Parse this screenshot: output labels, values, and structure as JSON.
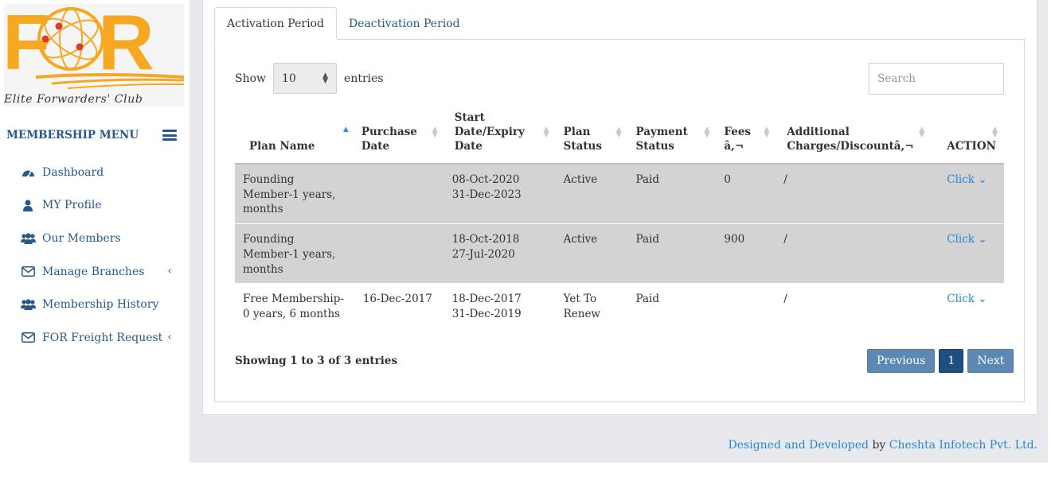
{
  "logo": {
    "tagline": "Elite Forwarders' Club",
    "brand_color": "#f7a823",
    "letters": "FOR"
  },
  "sidebar": {
    "title": "MEMBERSHIP MENU",
    "items": [
      {
        "label": "Dashboard",
        "icon": "dashboard-icon"
      },
      {
        "label": "MY Profile",
        "icon": "user-icon"
      },
      {
        "label": "Our Members",
        "icon": "users-icon"
      },
      {
        "label": "Manage Branches",
        "icon": "envelope-icon",
        "has_submenu": true
      },
      {
        "label": "Membership History",
        "icon": "users-icon"
      },
      {
        "label": "FOR Freight Request",
        "icon": "envelope-icon",
        "has_submenu": true
      }
    ]
  },
  "tabs": [
    {
      "label": "Activation Period",
      "active": true
    },
    {
      "label": "Deactivation Period",
      "active": false
    }
  ],
  "table_controls": {
    "show_label": "Show",
    "entries_value": "10",
    "entries_label": "entries",
    "search_placeholder": "Search"
  },
  "table": {
    "columns": [
      "Plan Name",
      "Purchase Date",
      "Start Date/Expiry Date",
      "Plan Status",
      "Payment Status",
      "Fees â,¬",
      "Additional Charges/Discountâ,¬",
      "ACTION"
    ],
    "sorted_column": "Plan Name",
    "rows": [
      {
        "plan_name": "Founding Member-1 years, months",
        "purchase_date": "",
        "start_date": "08-Oct-2020",
        "expiry_date": "31-Dec-2023",
        "plan_status": "Active",
        "payment_status": "Paid",
        "fees": "0",
        "additional": "/",
        "action": "Click"
      },
      {
        "plan_name": "Founding Member-1 years, months",
        "purchase_date": "",
        "start_date": "18-Oct-2018",
        "expiry_date": "27-Jul-2020",
        "plan_status": "Active",
        "payment_status": "Paid",
        "fees": "900",
        "additional": "/",
        "action": "Click"
      },
      {
        "plan_name": "Free Membership-0 years, 6 months",
        "purchase_date": "16-Dec-2017",
        "start_date": "18-Dec-2017",
        "expiry_date": "31-Dec-2019",
        "plan_status": "Yet To Renew",
        "payment_status": "Paid",
        "fees": "",
        "additional": "/",
        "action": "Click"
      }
    ]
  },
  "footer_info": "Showing 1 to 3 of 3 entries",
  "pagination": {
    "previous": "Previous",
    "current": "1",
    "next": "Next"
  },
  "footer": {
    "designed": "Designed and Developed",
    "by": "by",
    "company": "Cheshta Infotech Pvt. Ltd."
  },
  "colors": {
    "accent": "#25588d",
    "link": "#2a86d8",
    "row_shade": "#d3d3d3",
    "pager": "#5c88b3"
  }
}
